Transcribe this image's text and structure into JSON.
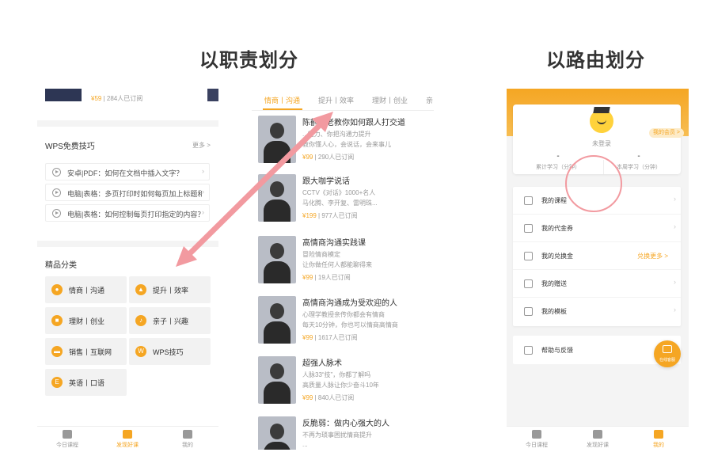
{
  "headings": {
    "by_function": "以职责划分",
    "by_route": "以路由划分"
  },
  "panel_a": {
    "top_item": {
      "price": "¥59",
      "subs": "284人已订阅"
    },
    "wps": {
      "title": "WPS免费技巧",
      "more": "更多 >",
      "tips": [
        "安卓|PDF：如何在文档中插入文字？",
        "电脑|表格：多页打印时如何每页加上标题和页...",
        "电脑|表格：如何控制每页打印指定的内容？"
      ]
    },
    "categories": {
      "title": "精品分类",
      "items": [
        {
          "label": "情商丨沟通",
          "icon": "chat-icon"
        },
        {
          "label": "提升丨效率",
          "icon": "rocket-icon"
        },
        {
          "label": "理财丨创业",
          "icon": "wallet-icon"
        },
        {
          "label": "亲子丨兴趣",
          "icon": "music-icon"
        },
        {
          "label": "销售丨互联网",
          "icon": "cart-icon"
        },
        {
          "label": "WPS技巧",
          "icon": "wps-icon"
        },
        {
          "label": "英语丨口语",
          "icon": "english-icon"
        }
      ]
    },
    "tabbar": [
      "今日课程",
      "发现好课",
      "我的"
    ]
  },
  "panel_b": {
    "tabs": [
      "情商丨沟通",
      "提升丨效率",
      "理财丨创业",
      "亲"
    ],
    "courses": [
      {
        "title": "陈鹤：老教你如何跟人打交道",
        "l1": "...能力、你把沟通力提升",
        "l2": "教你懂人心，会说话，会来事儿",
        "price": "¥99",
        "subs": "290人已订阅"
      },
      {
        "title": "跟大咖学说话",
        "l1": "CCTV《对话》1000+名人",
        "l2": "马化腾、李开复、雷明珠...",
        "price": "¥199",
        "subs": "977人已订阅"
      },
      {
        "title": "高情商沟通实践课",
        "l1": "冒险情商模定",
        "l2": "让你做任何人都能聊得来",
        "price": "¥99",
        "subs": "19人已订阅"
      },
      {
        "title": "高情商沟通成为受欢迎的人",
        "l1": "心理学教授亲传你都会有情商",
        "l2": "每天10分钟，你也可以情商高情商",
        "price": "¥99",
        "subs": "1617人已订阅"
      },
      {
        "title": "超强人脉术",
        "l1": "人脉33“技”，你都了解吗",
        "l2": "高质量人脉让你少奋斗10年",
        "price": "¥99",
        "subs": "840人已订阅"
      },
      {
        "title": "反脆弱：做内心强大的人",
        "l1": "不再为琐事困扰情商提升",
        "l2": "...",
        "price": "",
        "subs": ""
      }
    ]
  },
  "panel_c": {
    "username": "未登录",
    "badge": "我的会员 >",
    "stats": [
      {
        "value": "-",
        "label": "累计学习（分钟）"
      },
      {
        "value": "-",
        "label": "本周学习（分钟）"
      }
    ],
    "menu": [
      {
        "label": "我的课程",
        "extra": ""
      },
      {
        "label": "我的代金券",
        "extra": ""
      },
      {
        "label": "我的兑换金",
        "extra": "兑换更多 >"
      },
      {
        "label": "我的赠送",
        "extra": ""
      },
      {
        "label": "我的模板",
        "extra": ""
      }
    ],
    "help": "帮助与反馈",
    "fab": "在线客服",
    "tabbar": [
      "今日课程",
      "发现好课",
      "我的"
    ]
  },
  "colors": {
    "accent": "#f5a623",
    "arrow": "#f29aa0"
  }
}
